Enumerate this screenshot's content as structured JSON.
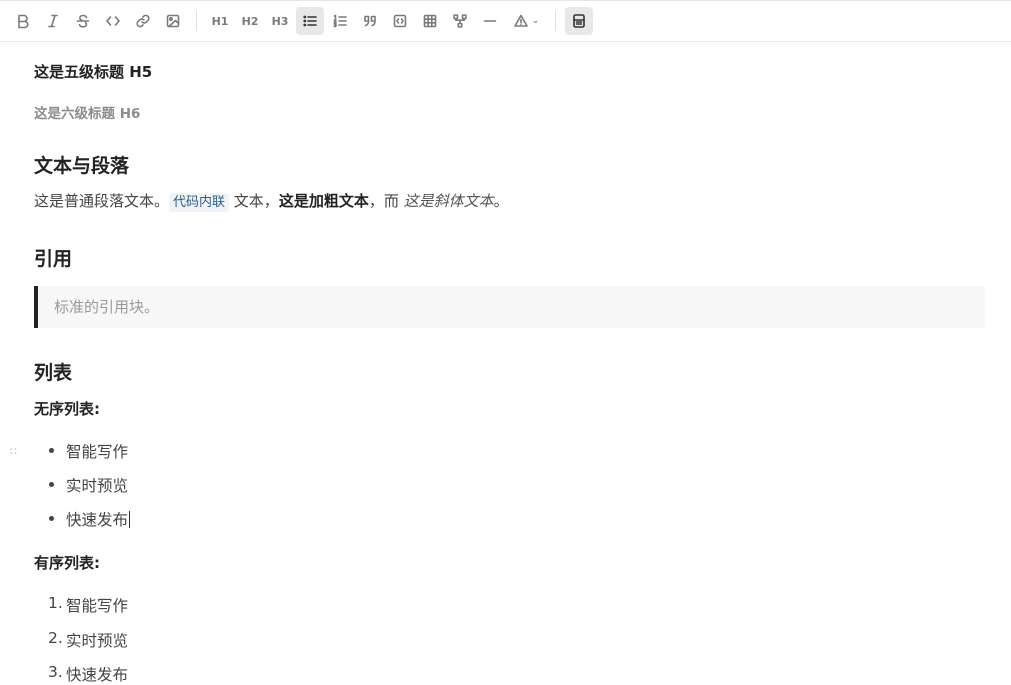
{
  "toolbar": {
    "buttons": [
      {
        "name": "bold-icon",
        "label": "B"
      },
      {
        "name": "italic-icon",
        "label": "I"
      },
      {
        "name": "strikethrough-icon",
        "label": "S"
      },
      {
        "name": "code-icon",
        "label": ""
      },
      {
        "name": "link-icon",
        "label": ""
      },
      {
        "name": "image-icon",
        "label": ""
      }
    ],
    "h1_label": "H1",
    "h2_label": "H2",
    "h3_label": "H3",
    "active_color": "#e8e8e8"
  },
  "doc": {
    "h5": "这是五级标题 H5",
    "h6": "这是六级标题 H6",
    "section_text_title": "文本与段落",
    "para": {
      "plain1": "这是普通段落文本。",
      "code": "代码内联",
      "plain2": " 文本，",
      "bold": "这是加粗文本",
      "plain3": "，而 ",
      "italic": "这是斜体文本",
      "plain4": "。"
    },
    "section_quote_title": "引用",
    "quote_text": "标准的引用块。",
    "section_list_title": "列表",
    "unordered_label": "无序列表:",
    "unordered_items": [
      "智能写作",
      "实时预览",
      "快速发布"
    ],
    "ordered_label": "有序列表:",
    "ordered_items": [
      {
        "num": "1.",
        "text": "智能写作"
      },
      {
        "num": "2.",
        "text": "实时预览"
      },
      {
        "num": "3.",
        "text": "快速发布"
      }
    ],
    "drag_handle": "∷"
  }
}
